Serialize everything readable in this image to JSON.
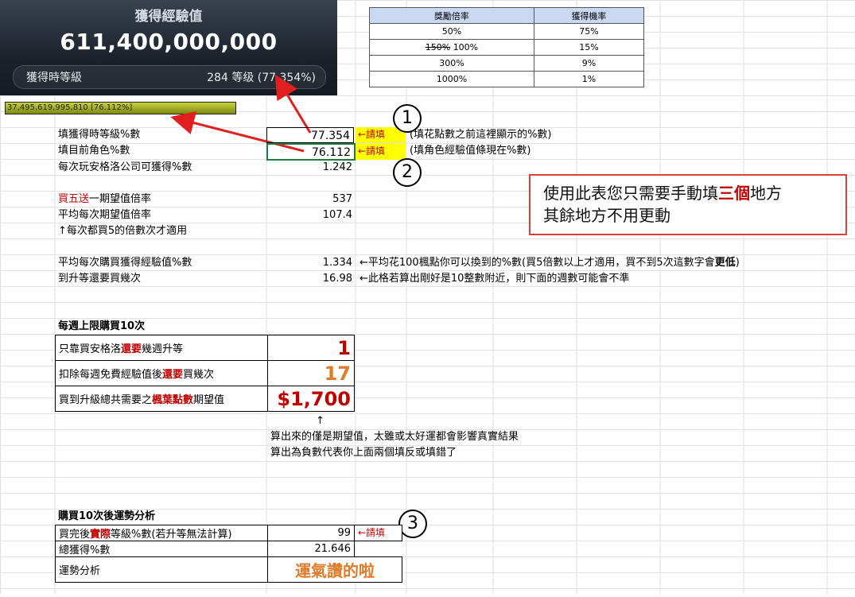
{
  "game_panel": {
    "title": "獲得經驗值",
    "exp_amount": "611,400,000,000",
    "level_label": "獲得時等級",
    "level_value": "284 等级 (77.354%)"
  },
  "exp_bar_text": "37,495,619,995,810 [76.112%]",
  "rate_table": {
    "headers": [
      "獎勵倍率",
      "獲得機率"
    ],
    "rows": [
      {
        "rate": "50%",
        "prob": "75%"
      },
      {
        "rate_strike": "150%",
        "rate": "100%",
        "prob": "15%"
      },
      {
        "rate": "300%",
        "prob": "9%"
      },
      {
        "rate": "1000%",
        "prob": "1%"
      }
    ]
  },
  "markers": [
    "1",
    "2",
    "3"
  ],
  "fill_label": "←請填",
  "rows": {
    "r1": {
      "label": "填獲得時等級%數",
      "value": "77.354",
      "note": "(填花點數之前這裡顯示的%數)"
    },
    "r2": {
      "label": "填目前角色%數",
      "value": "76.112",
      "note": "(填角色經驗值條現在%數)"
    },
    "r3": {
      "label": "每次玩安格洛公司可獲得%數",
      "value": "1.242"
    },
    "r4": {
      "label_red": "買五送",
      "label": "一期望值倍率",
      "value": "537"
    },
    "r5": {
      "label": "平均每次期望值倍率",
      "value": "107.4"
    },
    "r6": {
      "label": "↑每次都買5的倍數次才適用"
    },
    "r7": {
      "label": "平均每次購買獲得經驗值%數",
      "value": "1.334",
      "note_a": "←平均花100楓點你可以換到的%數(買5倍數以上才適用，買不到5次這數字會",
      "note_b": "更低",
      "note_c": ")"
    },
    "r8": {
      "label": "到升等還要買幾次",
      "value": "16.98",
      "note": "←此格若算出剛好是10整數附近，則下面的週數可能會不準"
    }
  },
  "weekly": {
    "title": "每週上限購買10次",
    "rows": [
      {
        "a": "只靠買安格洛",
        "b": "還要",
        "c": "幾週升等",
        "value": "1"
      },
      {
        "a": "扣除每週免費經驗值後",
        "b": "還要",
        "c": "買幾次",
        "value": "17"
      },
      {
        "a": "買到升級總共需要之",
        "b": "楓葉點數",
        "c": "期望值",
        "value": "$1,700"
      }
    ],
    "arrow": "↑",
    "note1": "算出來的僅是期望值，太雖或太好運都會影響真實結果",
    "note2": "算出為負數代表你上面兩個填反或填錯了"
  },
  "luck": {
    "title": "購買10次後運勢分析",
    "row1": {
      "a": "買完後",
      "b": "實際",
      "c": "等級%數(若升等無法計算)",
      "value": "99"
    },
    "row2": {
      "label": "總獲得%數",
      "value": "21.646"
    },
    "row3": {
      "label": "運勢分析",
      "value": "運氣讚的啦"
    }
  },
  "notice": {
    "line1_a": "使用此表您只需要手動填",
    "line1_b": "三個",
    "line1_c": "地方",
    "line2": "其餘地方不用更動"
  },
  "colors": {
    "accent_red": "#c00000",
    "fill_yellow": "#ffff00",
    "orange": "#e07b2a",
    "header_blue": "#c9d9f1"
  }
}
